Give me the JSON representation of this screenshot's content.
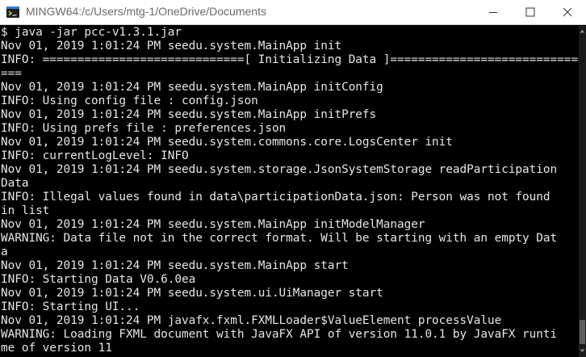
{
  "window": {
    "title": "MINGW64:/c/Users/mtg-1/OneDrive/Documents",
    "icon": "mingw-terminal-icon",
    "controls": [
      "minimize-icon",
      "maximize-icon",
      "close-icon"
    ]
  },
  "colors": {
    "background": "#000000",
    "text": "#e6e6e6",
    "titlebar": "#ffffff",
    "title_text": "#6a6a6a"
  },
  "console": {
    "lines": [
      "$ java -jar pcc-v1.3.1.jar",
      "Nov 01, 2019 1:01:24 PM seedu.system.MainApp init",
      "INFO: =============================[ Initializing Data ]=====================================",
      "===",
      "Nov 01, 2019 1:01:24 PM seedu.system.MainApp initConfig",
      "INFO: Using config file : config.json",
      "Nov 01, 2019 1:01:24 PM seedu.system.MainApp initPrefs",
      "INFO: Using prefs file : preferences.json",
      "Nov 01, 2019 1:01:24 PM seedu.system.commons.core.LogsCenter init",
      "INFO: currentLogLevel: INFO",
      "Nov 01, 2019 1:01:24 PM seedu.system.storage.JsonSystemStorage readParticipation",
      "Data",
      "INFO: Illegal values found in data\\participationData.json: Person was not found",
      "in list",
      "Nov 01, 2019 1:01:24 PM seedu.system.MainApp initModelManager",
      "WARNING: Data file not in the correct format. Will be starting with an empty Dat",
      "a",
      "Nov 01, 2019 1:01:24 PM seedu.system.MainApp start",
      "INFO: Starting Data V0.6.0ea",
      "Nov 01, 2019 1:01:24 PM seedu.system.ui.UiManager start",
      "INFO: Starting UI...",
      "Nov 01, 2019 1:01:24 PM javafx.fxml.FXMLLoader$ValueElement processValue",
      "WARNING: Loading FXML document with JavaFX API of version 11.0.1 by JavaFX runti",
      "me of version 11"
    ]
  }
}
